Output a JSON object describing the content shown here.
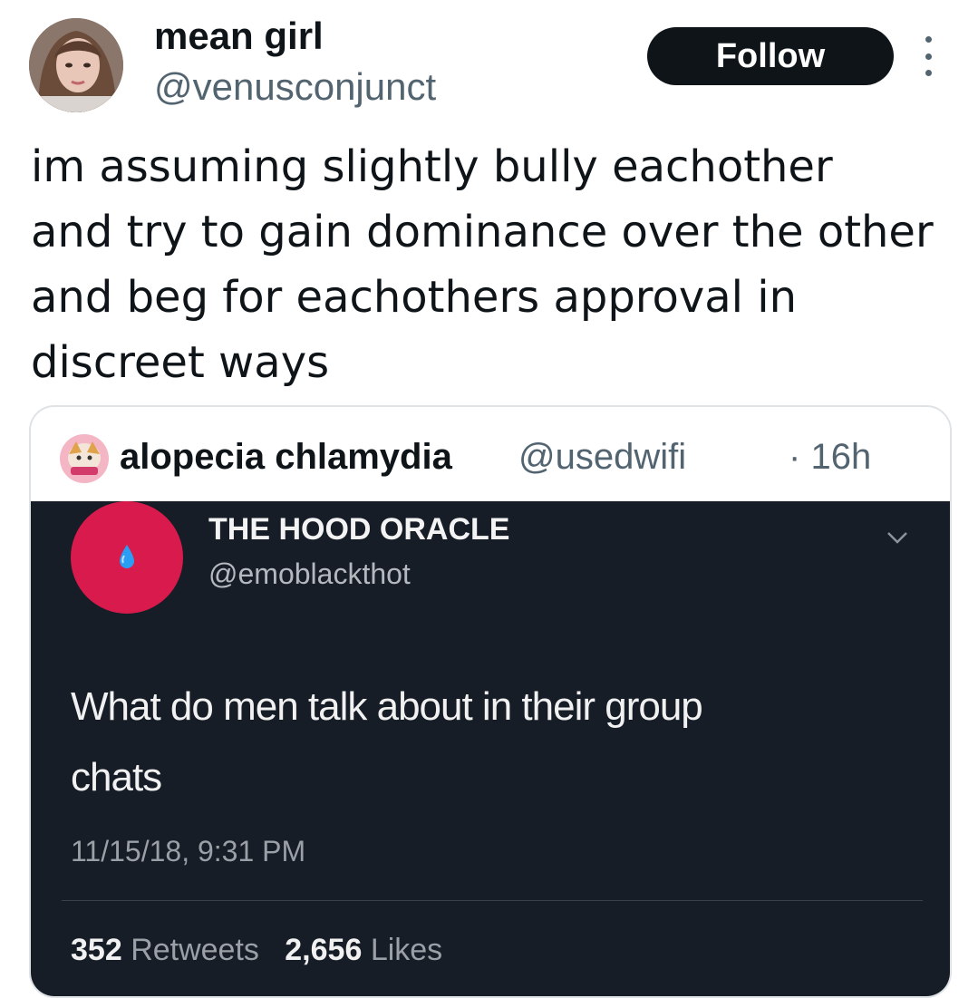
{
  "author": {
    "display_name": "mean girl",
    "handle": "@venusconjunct",
    "avatar_icon": "user-avatar-photo"
  },
  "actions": {
    "follow_label": "Follow",
    "more_icon": "more-vertical-icon"
  },
  "tweet": {
    "lines": [
      "im assuming slightly bully eachother",
      "and try to gain dominance over the other",
      "and beg for eachothers approval in",
      "discreet ways"
    ]
  },
  "quoted": {
    "display_name": "alopecia chlamydia",
    "handle": "@usedwifi",
    "separator": "·",
    "time": "16h",
    "image": {
      "name": "THE HOOD ORACLE",
      "handle": "@emoblackthot",
      "text_lines": [
        "What do men talk about in their group",
        "chats"
      ],
      "timestamp": "11/15/18, 9:31 PM",
      "retweets_count": "352",
      "retweets_label": "Retweets",
      "likes_count": "2,656",
      "likes_label": "Likes"
    }
  },
  "colors": {
    "text_primary": "#0f1419",
    "text_secondary": "#536471",
    "follow_bg": "#0f1419",
    "card_border": "#dfe3e6",
    "image_bg": "#161d27",
    "oracle_avatar": "#d81b4c",
    "droplet": "#2a9df4"
  }
}
